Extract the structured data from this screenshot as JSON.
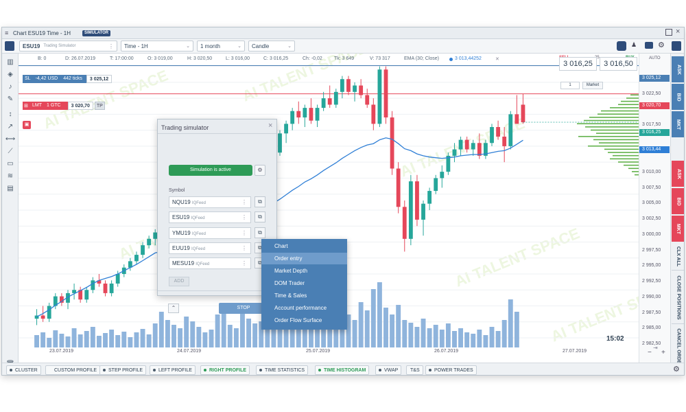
{
  "titlebar": {
    "title": "Chart ESU19 Time - 1H",
    "badge": "SIMULATOR",
    "menu_icon": "hamburger-icon",
    "maximize_icon": "maximize-icon",
    "close_icon": "close-icon"
  },
  "toolbar": {
    "symbol": "ESU19",
    "symbol_sub": "Trading Simulator",
    "timeframe": "Time - 1H",
    "period": "1 month",
    "chart_type": "Candle"
  },
  "ohlc": {
    "b": "B: 0",
    "d": "D: 26.07.2019",
    "t": "T: 17:00:00",
    "o": "O: 3 019,00",
    "h": "H: 3 020,50",
    "l": "L: 3 016,00",
    "c": "C: 3 016,25",
    "ch": "Ch: -0,02",
    "tk": "Tk: 3 649",
    "v": "V: 73 317",
    "ema": "EMA (30; Close)",
    "ema_val": "3 013,44252",
    "ema_close": "✕"
  },
  "orders": {
    "sl_label": "SL",
    "sl_usd": "-4,42 USD",
    "sl_ticks": "442 ticks",
    "sl_price": "3 025,12",
    "lmt_label": "LMT",
    "lmt_qty": "1 GTC",
    "lmt_price": "3 020,70",
    "tp_label": "TP"
  },
  "trade_panel": {
    "sell_label": "SELL",
    "spread": "25",
    "buy_label": "BUY",
    "sell_price": "3 016,25",
    "buy_price": "3 016,50",
    "qty": "1",
    "order_type": "Market",
    "auto_label": "AUTO"
  },
  "price_axis": {
    "ticks": [
      "3 025,12",
      "3 022,50",
      "3 020,70",
      "3 017,50",
      "3 016,25",
      "3 013,44",
      "3 010,00",
      "3 007,50",
      "3 005,00",
      "3 002,50",
      "3 000,00",
      "2 997,50",
      "2 995,00",
      "2 992,50",
      "2 990,00",
      "2 987,50",
      "2 985,00",
      "2 982,50"
    ],
    "time": "15:02"
  },
  "date_axis": {
    "ticks": [
      "23.07.2019",
      "24.07.2019",
      "25.07.2019",
      "26.07.2019",
      "27.07.2019"
    ]
  },
  "right_tabs": [
    "ASK",
    "BID",
    "MKT",
    "ASK",
    "BID",
    "MKT",
    "CLX ALL",
    "CLOSE POSITIONS",
    "CANCEL ORDER"
  ],
  "simulator": {
    "title": "Trading simulator",
    "status": "Simulation is active",
    "symbol_label": "Symbol",
    "symbols": [
      {
        "name": "NQU19",
        "feed": "IQFeed"
      },
      {
        "name": "ESU19",
        "feed": "IQFeed"
      },
      {
        "name": "YMU19",
        "feed": "IQFeed"
      },
      {
        "name": "EUU19",
        "feed": "IQFeed"
      },
      {
        "name": "MESU19",
        "feed": "IQFeed"
      }
    ],
    "add_label": "ADD",
    "stop_label": "STOP"
  },
  "context_menu": {
    "items": [
      "Chart",
      "Order entry",
      "Market Depth",
      "DOM Trader",
      "Time & Sales",
      "Account performance",
      "Order Flow Surface"
    ],
    "highlighted": 1
  },
  "bottom_tabs": [
    "CLUSTER",
    "CUSTOM PROFILE",
    "STEP PROFILE",
    "LEFT PROFILE",
    "RIGHT PROFILE",
    "TIME STATISTICS",
    "TIME HISTOGRAM",
    "VWAP",
    "T&S",
    "POWER TRADES"
  ],
  "bottom_active": [
    "RIGHT PROFILE",
    "TIME HISTOGRAM"
  ],
  "watermark": "AI TALENT SPACE",
  "colors": {
    "up": "#26a69a",
    "down": "#e5475a",
    "ema": "#2f7fd6",
    "volume": "#8fb4dc",
    "profile": "#61b14a",
    "accent": "#2e9b57"
  },
  "chart_data": {
    "type": "candlestick",
    "ylim": [
      2981,
      3027
    ],
    "candles": [
      [
        2985.5,
        2987.0,
        2984.5,
        2986.0
      ],
      [
        2986.0,
        2987.5,
        2985.0,
        2985.5
      ],
      [
        2985.5,
        2988.0,
        2985.0,
        2987.5
      ],
      [
        2987.5,
        2989.5,
        2987.0,
        2989.0
      ],
      [
        2989.0,
        2989.5,
        2987.5,
        2988.0
      ],
      [
        2988.0,
        2990.0,
        2987.0,
        2989.5
      ],
      [
        2989.5,
        2991.0,
        2988.5,
        2990.0
      ],
      [
        2990.0,
        2990.5,
        2988.0,
        2988.5
      ],
      [
        2988.5,
        2990.5,
        2988.0,
        2990.0
      ],
      [
        2990.0,
        2992.0,
        2989.5,
        2991.5
      ],
      [
        2991.5,
        2992.5,
        2990.5,
        2991.0
      ],
      [
        2991.0,
        2991.5,
        2989.0,
        2989.5
      ],
      [
        2989.5,
        2991.5,
        2989.0,
        2991.0
      ],
      [
        2991.0,
        2993.0,
        2990.5,
        2992.5
      ],
      [
        2992.5,
        2994.0,
        2992.0,
        2993.5
      ],
      [
        2993.5,
        2995.0,
        2993.0,
        2994.5
      ],
      [
        2994.5,
        2996.0,
        2994.0,
        2995.5
      ],
      [
        2995.5,
        2997.5,
        2995.0,
        2997.0
      ],
      [
        2997.0,
        2998.5,
        2996.5,
        2998.0
      ],
      [
        2998.0,
        2999.5,
        2997.0,
        2999.0
      ],
      [
        2999.0,
        3000.0,
        2997.5,
        2998.0
      ],
      [
        2998.0,
        2998.5,
        2992.0,
        2993.0
      ],
      [
        2993.0,
        2993.5,
        2990.0,
        2991.0
      ],
      [
        2991.0,
        2994.0,
        2990.5,
        2993.5
      ],
      [
        2993.5,
        2996.0,
        2993.0,
        2995.5
      ],
      [
        2995.5,
        2997.0,
        2993.5,
        2994.0
      ],
      [
        2994.0,
        3000.5,
        2993.5,
        3000.0
      ],
      [
        3000.0,
        3005.5,
        2999.5,
        3005.0
      ],
      [
        3005.0,
        3007.5,
        3003.5,
        3004.0
      ],
      [
        3004.0,
        3006.0,
        3002.0,
        3005.5
      ],
      [
        3005.5,
        3008.5,
        3005.0,
        3008.0
      ],
      [
        3008.0,
        3010.0,
        3007.5,
        3009.0
      ],
      [
        3009.0,
        3009.5,
        3004.0,
        3005.0
      ],
      [
        3005.0,
        3008.0,
        3004.5,
        3007.5
      ],
      [
        3007.5,
        3010.5,
        3007.0,
        3010.0
      ],
      [
        3010.0,
        3013.0,
        3009.5,
        3012.5
      ],
      [
        3012.5,
        3014.5,
        3011.5,
        3014.0
      ],
      [
        3014.0,
        3015.5,
        3009.0,
        3010.0
      ],
      [
        3010.0,
        3012.0,
        3008.5,
        3011.5
      ],
      [
        3011.5,
        3015.0,
        3011.0,
        3014.5
      ],
      [
        3014.5,
        3016.5,
        3013.0,
        3016.0
      ],
      [
        3016.0,
        3018.5,
        3015.0,
        3018.0
      ],
      [
        3018.0,
        3019.5,
        3016.0,
        3017.0
      ],
      [
        3017.0,
        3019.0,
        3015.5,
        3018.5
      ],
      [
        3018.5,
        3020.0,
        3016.0,
        3016.5
      ],
      [
        3016.5,
        3019.0,
        3015.5,
        3018.5
      ],
      [
        3018.5,
        3021.0,
        3018.0,
        3020.0
      ],
      [
        3020.0,
        3022.0,
        3018.5,
        3019.0
      ],
      [
        3019.0,
        3021.5,
        3018.5,
        3021.0
      ],
      [
        3021.0,
        3023.5,
        3020.0,
        3023.0
      ],
      [
        3023.0,
        3023.5,
        3020.5,
        3021.0
      ],
      [
        3021.0,
        3022.5,
        3019.5,
        3022.0
      ],
      [
        3022.0,
        3023.0,
        3020.0,
        3020.5
      ],
      [
        3020.5,
        3021.5,
        3018.5,
        3019.0
      ],
      [
        3019.0,
        3020.0,
        3015.0,
        3016.0
      ],
      [
        3016.0,
        3025.0,
        3015.5,
        3024.5
      ],
      [
        3024.5,
        3025.0,
        3016.0,
        3017.0
      ],
      [
        3017.0,
        3018.0,
        3008.0,
        3009.0
      ],
      [
        3009.0,
        3010.0,
        3002.0,
        3003.0
      ],
      [
        3003.0,
        3004.0,
        2996.0,
        2998.0
      ],
      [
        2998.0,
        3008.0,
        2997.0,
        3007.0
      ],
      [
        3007.0,
        3008.0,
        3000.0,
        3001.0
      ],
      [
        3001.0,
        3004.0,
        2998.5,
        3003.5
      ],
      [
        3003.5,
        3006.0,
        3002.5,
        3005.5
      ],
      [
        3005.5,
        3008.0,
        3005.0,
        3007.5
      ],
      [
        3007.5,
        3009.5,
        3006.0,
        3008.5
      ],
      [
        3008.5,
        3011.5,
        3008.0,
        3011.0
      ],
      [
        3011.0,
        3013.0,
        3010.0,
        3012.0
      ],
      [
        3012.0,
        3014.0,
        3011.0,
        3013.5
      ],
      [
        3013.5,
        3014.0,
        3011.5,
        3012.0
      ],
      [
        3012.0,
        3013.5,
        3011.0,
        3013.0
      ],
      [
        3013.0,
        3014.5,
        3010.5,
        3011.0
      ],
      [
        3011.0,
        3013.5,
        3010.5,
        3013.0
      ],
      [
        3013.0,
        3016.0,
        3012.5,
        3015.5
      ],
      [
        3015.5,
        3016.5,
        3013.5,
        3014.0
      ],
      [
        3014.0,
        3015.5,
        3010.0,
        3012.5
      ],
      [
        3012.5,
        3018.0,
        3012.0,
        3017.5
      ],
      [
        3017.5,
        3020.5,
        3016.5,
        3016.0
      ],
      [
        3019.0,
        3020.7,
        3016.0,
        3016.25
      ]
    ],
    "volume": [
      18,
      22,
      14,
      25,
      20,
      16,
      28,
      19,
      24,
      30,
      17,
      21,
      26,
      18,
      23,
      15,
      22,
      27,
      19,
      35,
      52,
      40,
      33,
      28,
      45,
      38,
      30,
      22,
      26,
      48,
      55,
      33,
      28,
      60,
      42,
      35,
      38,
      31,
      44,
      58,
      40,
      30,
      72,
      36,
      46,
      29,
      38,
      42,
      35,
      30,
      48,
      40,
      66,
      54,
      85,
      95,
      58,
      48,
      62,
      40,
      36,
      30,
      42,
      28,
      33,
      26,
      35,
      24,
      28,
      22,
      20,
      26,
      18,
      30,
      24,
      40,
      70,
      52
    ],
    "ema": [
      2985.8,
      2986.3,
      2986.9,
      2987.6,
      2988.2,
      2988.9,
      2989.4,
      2989.9,
      2990.4,
      2991.0,
      2991.5,
      2991.8,
      2992.1,
      2992.5,
      2993.0,
      2993.5,
      2994.0,
      2994.6,
      2995.2,
      2995.8,
      2996.0,
      2995.9,
      2995.7,
      2995.8,
      2996.0,
      2996.1,
      2996.6,
      2997.3,
      2997.9,
      2998.4,
      2999.0,
      2999.7,
      3000.1,
      3000.6,
      3001.2,
      3001.9,
      3002.6,
      3003.1,
      3003.6,
      3004.2,
      3004.9,
      3005.6,
      3006.2,
      3006.9,
      3007.4,
      3008.0,
      3008.7,
      3009.3,
      3009.9,
      3010.6,
      3011.2,
      3011.8,
      3012.3,
      3012.7,
      3012.9,
      3013.5,
      3013.8,
      3013.6,
      3012.9,
      3012.1,
      3011.8,
      3011.3,
      3011.0,
      3010.8,
      3010.7,
      3010.6,
      3010.7,
      3010.8,
      3011.0,
      3011.1,
      3011.2,
      3011.2,
      3011.3,
      3011.5,
      3011.7,
      3011.8,
      3012.2,
      3012.8,
      3013.44
    ],
    "profile": [
      [
        3020.5,
        12
      ],
      [
        3020.0,
        18
      ],
      [
        3019.5,
        26
      ],
      [
        3019.0,
        30
      ],
      [
        3018.5,
        42
      ],
      [
        3018.0,
        55
      ],
      [
        3017.5,
        60
      ],
      [
        3017.0,
        72
      ],
      [
        3016.5,
        80
      ],
      [
        3016.0,
        90
      ],
      [
        3015.5,
        78
      ],
      [
        3015.0,
        70
      ],
      [
        3014.5,
        62
      ],
      [
        3014.0,
        88
      ],
      [
        3013.5,
        66
      ],
      [
        3013.0,
        58
      ],
      [
        3012.5,
        74
      ],
      [
        3012.0,
        50
      ],
      [
        3011.5,
        45
      ],
      [
        3011.0,
        38
      ],
      [
        3010.5,
        42
      ],
      [
        3010.0,
        30
      ],
      [
        3009.5,
        22
      ],
      [
        3009.0,
        15
      ],
      [
        3008.5,
        10
      ],
      [
        3008.0,
        6
      ]
    ]
  }
}
